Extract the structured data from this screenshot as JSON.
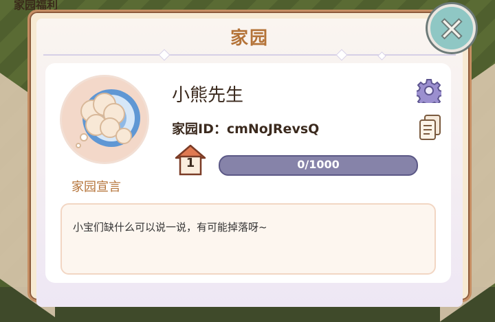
{
  "background": {
    "label": "家园福利"
  },
  "dialog": {
    "title": "家园"
  },
  "profile": {
    "name": "小熊先生",
    "home_id_label": "家园ID：cmNoJRevsQ",
    "declaration_label": "家园宣言",
    "declaration_text": "小宝们缺什么可以说一说，有可能掉落呀~"
  },
  "level": {
    "value": "1",
    "exp_text": "0/1000",
    "exp_current": 0,
    "exp_max": 1000
  },
  "icons": {
    "close": "close-icon",
    "settings": "gear-icon",
    "copy": "copy-icon",
    "avatar": "cloud-avatar-icon",
    "level": "house-icon"
  },
  "colors": {
    "title": "#b47338",
    "close_button": "#8fc7c4",
    "exp_bar": "#8683a9"
  }
}
